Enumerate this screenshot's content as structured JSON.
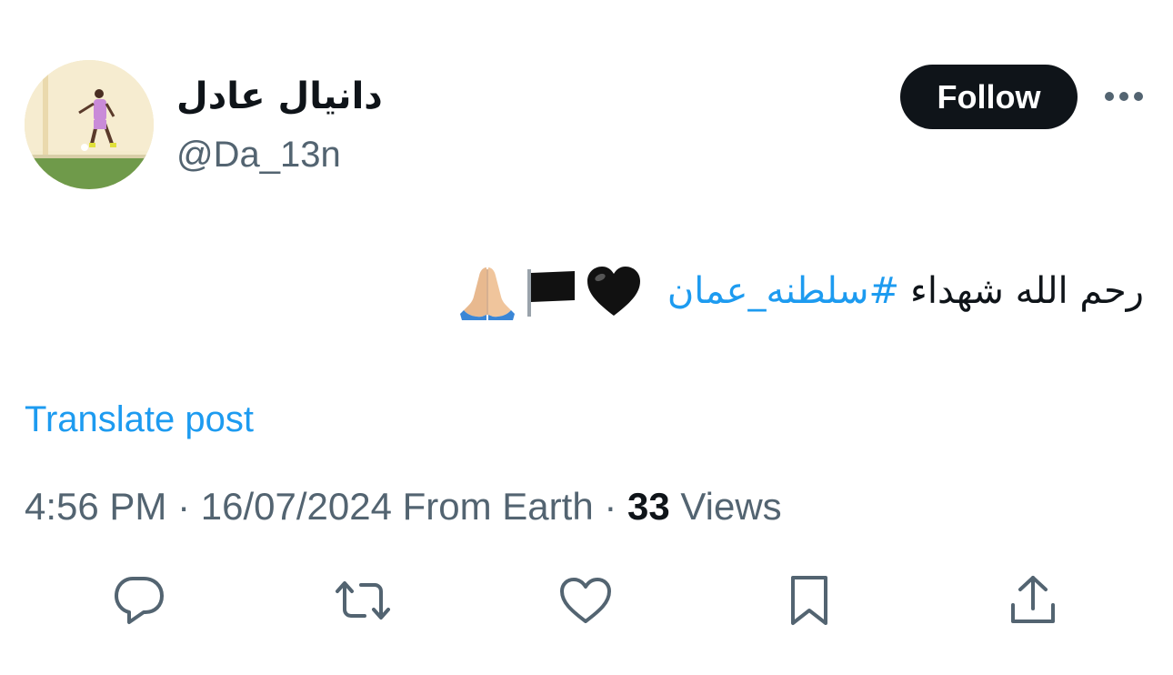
{
  "author": {
    "display_name": "دانيال عادل",
    "handle": "@Da_13n"
  },
  "header": {
    "follow_label": "Follow"
  },
  "post": {
    "text": "رحم الله شهداء",
    "hashtag": "#سلطنه_عمان",
    "emojis": [
      "black-heart",
      "black-flag",
      "folded-hands"
    ]
  },
  "translate_label": "Translate post",
  "meta": {
    "time": "4:56 PM",
    "sep1": " · ",
    "date": "16/07/2024",
    "source": " From Earth",
    "sep2": " · ",
    "views_count": "33",
    "views_label": " Views"
  },
  "icons": {
    "reply": "reply-icon",
    "repost": "repost-icon",
    "like": "like-icon",
    "bookmark": "bookmark-icon",
    "share": "share-icon",
    "more": "more-icon"
  },
  "colors": {
    "text": "#0f1419",
    "secondary": "#536471",
    "link": "#1d9bf0",
    "button_bg": "#0f1419",
    "button_text": "#ffffff"
  }
}
